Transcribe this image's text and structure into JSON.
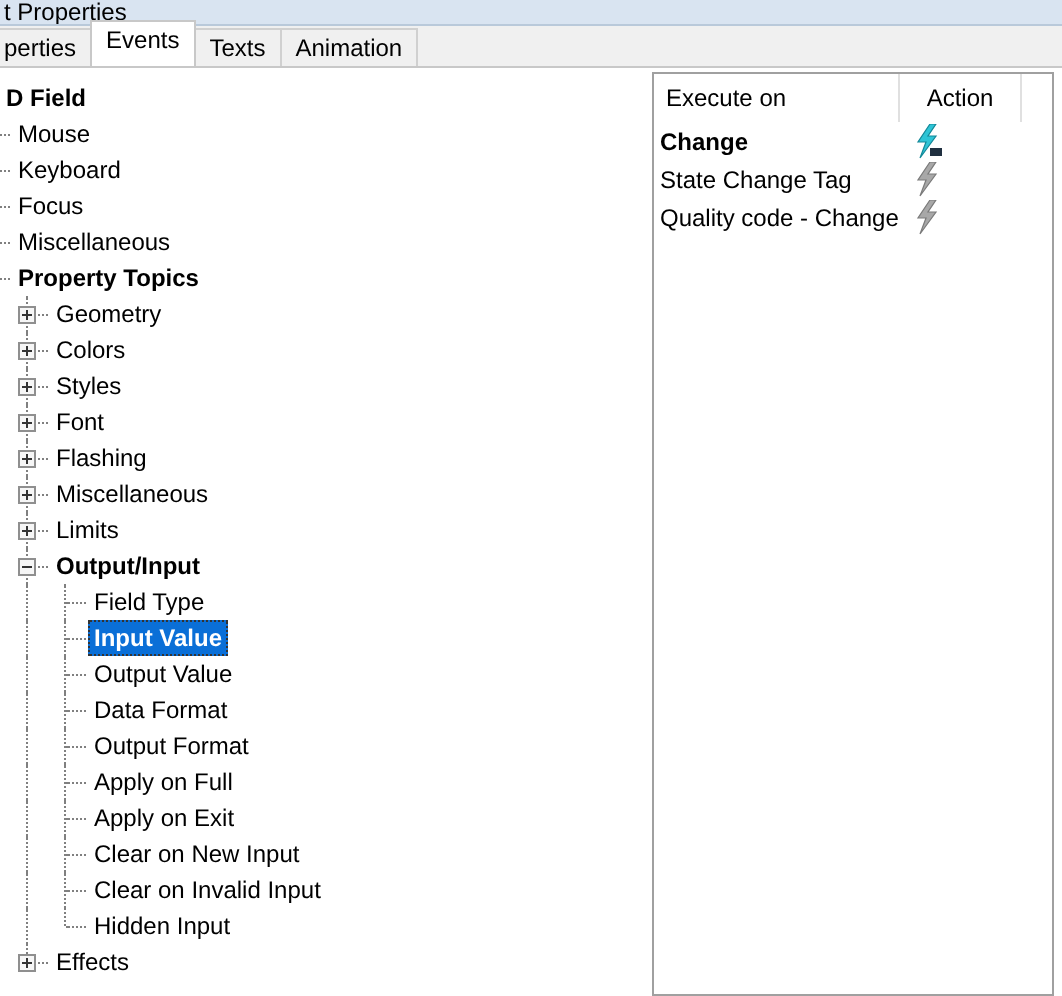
{
  "window": {
    "title": "t Properties"
  },
  "tabs": [
    {
      "label": "perties",
      "selected": false
    },
    {
      "label": "Events",
      "selected": true
    },
    {
      "label": "Texts",
      "selected": false
    },
    {
      "label": "Animation",
      "selected": false
    }
  ],
  "tree": [
    {
      "label": "D Field",
      "bold": true,
      "selected": false,
      "children": [
        {
          "label": "Mouse",
          "bold": false,
          "selected": false
        },
        {
          "label": "Keyboard",
          "bold": false,
          "selected": false
        },
        {
          "label": "Focus",
          "bold": false,
          "selected": false
        },
        {
          "label": "Miscellaneous",
          "bold": false,
          "selected": false
        },
        {
          "label": "Property Topics",
          "bold": true,
          "selected": false,
          "children": [
            {
              "label": "Geometry",
              "bold": false,
              "selected": false,
              "expanded": false
            },
            {
              "label": "Colors",
              "bold": false,
              "selected": false,
              "expanded": false
            },
            {
              "label": "Styles",
              "bold": false,
              "selected": false,
              "expanded": false
            },
            {
              "label": "Font",
              "bold": false,
              "selected": false,
              "expanded": false
            },
            {
              "label": "Flashing",
              "bold": false,
              "selected": false,
              "expanded": false
            },
            {
              "label": "Miscellaneous",
              "bold": false,
              "selected": false,
              "expanded": false
            },
            {
              "label": "Limits",
              "bold": false,
              "selected": false,
              "expanded": false
            },
            {
              "label": "Output/Input",
              "bold": true,
              "selected": false,
              "expanded": true,
              "children": [
                {
                  "label": "Field Type",
                  "bold": false,
                  "selected": false
                },
                {
                  "label": "Input Value",
                  "bold": true,
                  "selected": true
                },
                {
                  "label": "Output Value",
                  "bold": false,
                  "selected": false
                },
                {
                  "label": "Data Format",
                  "bold": false,
                  "selected": false
                },
                {
                  "label": "Output Format",
                  "bold": false,
                  "selected": false
                },
                {
                  "label": "Apply on Full",
                  "bold": false,
                  "selected": false
                },
                {
                  "label": "Apply on Exit",
                  "bold": false,
                  "selected": false
                },
                {
                  "label": "Clear on New Input",
                  "bold": false,
                  "selected": false
                },
                {
                  "label": "Clear on Invalid Input",
                  "bold": false,
                  "selected": false
                },
                {
                  "label": "Hidden Input",
                  "bold": false,
                  "selected": false
                }
              ]
            },
            {
              "label": "Effects",
              "bold": false,
              "selected": false,
              "expanded": false
            }
          ]
        }
      ]
    }
  ],
  "events_table": {
    "columns": [
      "Execute on",
      "Action"
    ],
    "rows": [
      {
        "execute_on": "Change",
        "bold": true,
        "has_script": true
      },
      {
        "execute_on": "State Change Tag",
        "bold": false,
        "has_script": false
      },
      {
        "execute_on": "Quality code - Change",
        "bold": false,
        "has_script": false
      }
    ]
  }
}
